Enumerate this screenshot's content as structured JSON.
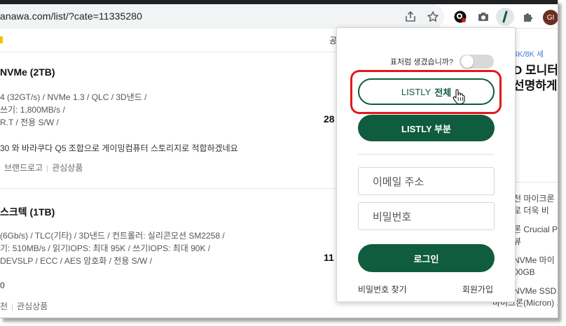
{
  "browser": {
    "url": "anawa.com/list/?cate=11335280",
    "profile_initials": "GI",
    "icons": [
      "share-icon",
      "star-icon",
      "listly-extension-icon",
      "camera-icon",
      "slash-extension-icon",
      "puzzle-icon"
    ]
  },
  "page": {
    "price_header": "공",
    "products": [
      {
        "title": "NVMe (2TB)",
        "specs": [
          "4 (32GT/s) / NVMe 1.3 / QLC / 3D낸드 /",
          "쓰기: 1,800MB/s /",
          "R.T / 전용 S/W /"
        ],
        "review": "30 와 바라쿠다 Q5 조합으로 게이밍컴퓨터 스토리지로 적합하겠네요",
        "links": [
          "브랜드로고",
          "관심상품"
        ],
        "price": "28"
      },
      {
        "title": "스크텍 (1TB)",
        "specs": [
          "(6Gb/s) / TLC(기타) / 3D낸드 / 컨트롤러: 실리콘모션 SM2258 /",
          "기: 510MB/s / 읽기IOPS: 최대 95K / 쓰기IOPS: 최대 90K /",
          "DEVSLP / ECC / AES 암호화 / 전용 S/W /"
        ],
        "review": "0",
        "links": [
          "천",
          "관심상품"
        ],
        "price": "11"
      }
    ],
    "sidebar": {
      "ad_small": "4K/8K 세",
      "ad_title": [
        "D 모니터",
        "선명하게"
      ],
      "items": [
        "천 마이크론",
        "로 더욱 비",
        "론 Crucial P",
        "뷰",
        "NVMe 마이",
        "00GB",
        "NVMe SSD 도",
        "마이크론(Micron) 크"
      ]
    }
  },
  "popup": {
    "toggle_label": "표처럼 생겼습니까?",
    "toggle_on": false,
    "btn_full_prefix": "LISTLY",
    "btn_full_bold": "전체",
    "btn_part": "LISTLY 부분",
    "email_placeholder": "이메일 주소",
    "password_placeholder": "비밀번호",
    "login": "로그인",
    "forgot_password": "비밀번호 찾기",
    "signup": "회원가입",
    "colors": {
      "primary_green": "#0f5c3f",
      "highlight_red": "#e0191d"
    }
  }
}
